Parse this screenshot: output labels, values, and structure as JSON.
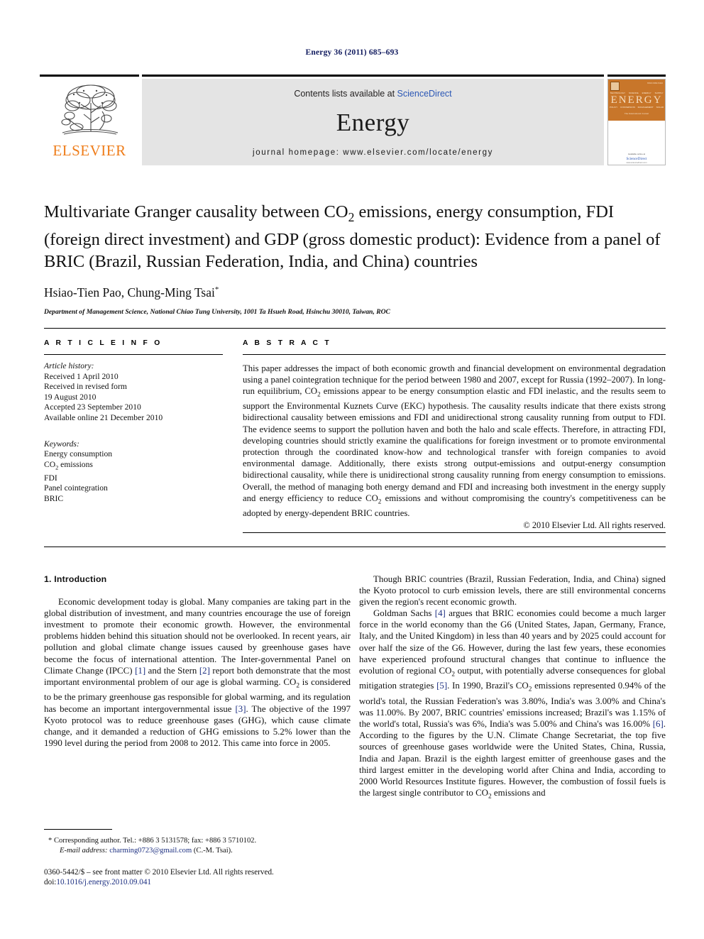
{
  "running_head": "Energy 36 (2011) 685–693",
  "masthead": {
    "publisher_logo_text": "ELSEVIER",
    "contents_prefix": "Contents lists available at ",
    "contents_link": "ScienceDirect",
    "journal_name": "Energy",
    "homepage": "journal homepage: www.elsevier.com/locate/energy",
    "cover": {
      "title": "ENERGY",
      "subtitle": "The International Journal",
      "code": "ISSN 0360-5442",
      "row_top": [
        "TECHNOLOGY",
        "SCIENCE",
        "ENERGY",
        "SUPPLY"
      ],
      "row_bottom": [
        "POLICY",
        "CONVERSION",
        "MANAGEMENT",
        "SOLAR"
      ],
      "avail_text": "Available online at",
      "sd_text": "ScienceDirect",
      "sd_url": "www.sciencedirect.com"
    }
  },
  "article": {
    "title_line1": "Multivariate Granger causality between CO",
    "title_line1_sub": "2",
    "title_line1_rest": " emissions, energy consumption, FDI",
    "title_line2": "(foreign direct investment) and GDP (gross domestic product): Evidence from",
    "title_line3": "a panel of BRIC (Brazil, Russian Federation, India, and China) countries",
    "authors": "Hsiao-Tien Pao, Chung-Ming Tsai",
    "author_marker": "*",
    "affiliation": "Department of Management Science, National Chiao Tung University, 1001 Ta Hsueh Road, Hsinchu 30010, Taiwan, ROC"
  },
  "info": {
    "heading": "A R T I C L E   I N F O",
    "history_label": "Article history:",
    "history": [
      "Received 1 April 2010",
      "Received in revised form",
      "19 August 2010",
      "Accepted 23 September 2010",
      "Available online 21 December 2010"
    ],
    "keywords_label": "Keywords:",
    "keywords": [
      "Energy consumption",
      "CO2 emissions",
      "FDI",
      "Panel cointegration",
      "BRIC"
    ]
  },
  "abstract": {
    "heading": "A B S T R A C T",
    "text": "This paper addresses the impact of both economic growth and financial development on environmental degradation using a panel cointegration technique for the period between 1980 and 2007, except for Russia (1992–2007). In long-run equilibrium, CO2 emissions appear to be energy consumption elastic and FDI inelastic, and the results seem to support the Environmental Kuznets Curve (EKC) hypothesis. The causality results indicate that there exists strong bidirectional causality between emissions and FDI and unidirectional strong causality running from output to FDI. The evidence seems to support the pollution haven and both the halo and scale effects. Therefore, in attracting FDI, developing countries should strictly examine the qualifications for foreign investment or to promote environmental protection through the coordinated know-how and technological transfer with foreign companies to avoid environmental damage. Additionally, there exists strong output-emissions and output-energy consumption bidirectional causality, while there is unidirectional strong causality running from energy consumption to emissions. Overall, the method of managing both energy demand and FDI and increasing both investment in the energy supply and energy efficiency to reduce CO2 emissions and without compromising the country's competitiveness can be adopted by energy-dependent BRIC countries.",
    "copyright": "© 2010 Elsevier Ltd. All rights reserved."
  },
  "body": {
    "section_heading": "1.  Introduction",
    "left_para_1": "Economic development today is global. Many companies are taking part in the global distribution of investment, and many countries encourage the use of foreign investment to promote their economic growth. However, the environmental problems hidden behind this situation should not be overlooked. In recent years, air pollution and global climate change issues caused by greenhouse gases have become the focus of international attention. The Inter-governmental Panel on Climate Change (IPCC) [1] and the Stern [2] report both demonstrate that the most important environmental problem of our age is global warming. CO2 is considered to be the primary greenhouse gas responsible for global warming, and its regulation has become an important intergovernmental issue [3]. The objective of the 1997 Kyoto protocol was to reduce greenhouse gases (GHG), which cause climate change, and it demanded a reduction of GHG emissions to 5.2% lower than the 1990 level during the period from 2008 to 2012. This came into force in 2005.",
    "right_para_1": "Though BRIC countries (Brazil, Russian Federation, India, and China) signed the Kyoto protocol to curb emission levels, there are still environmental concerns given the region's recent economic growth.",
    "right_para_2": "Goldman Sachs [4] argues that BRIC economies could become a much larger force in the world economy than the G6 (United States, Japan, Germany, France, Italy, and the United Kingdom) in less than 40 years and by 2025 could account for over half the size of the G6. However, during the last few years, these economies have experienced profound structural changes that continue to influence the evolution of regional CO2 output, with potentially adverse consequences for global mitigation strategies [5]. In 1990, Brazil's CO2 emissions represented 0.94% of the world's total, the Russian Federation's was 3.80%, India's was 3.00% and China's was 11.00%. By 2007, BRIC countries' emissions increased; Brazil's was 1.15% of the world's total, Russia's was 6%, India's was 5.00% and China's was 16.00% [6]. According to the figures by the U.N. Climate Change Secretariat, the top five sources of greenhouse gases worldwide were the United States, China, Russia, India and Japan. Brazil is the eighth largest emitter of greenhouse gases and the third largest emitter in the developing world after China and India, according to 2000 World Resources Institute figures. However, the combustion of fossil fuels is the largest single contributor to CO2 emissions and"
  },
  "footnote": {
    "corresponding": "* Corresponding author. Tel.: +886 3 5131578; fax: +886 3 5710102.",
    "email_label": "E-mail address:",
    "email": "charming0723@gmail.com",
    "email_suffix": " (C.-M. Tsai)."
  },
  "imprint": {
    "line1": "0360-5442/$ – see front matter © 2010 Elsevier Ltd. All rights reserved.",
    "doi_label": "doi:",
    "doi": "10.1016/j.energy.2010.09.041"
  },
  "colors": {
    "link": "#1c2f81",
    "sciencedirect": "#2b57b5",
    "elsevier_orange": "#ef7d1a",
    "running_head": "#101a5e",
    "band_bg": "#e4e4e4"
  }
}
